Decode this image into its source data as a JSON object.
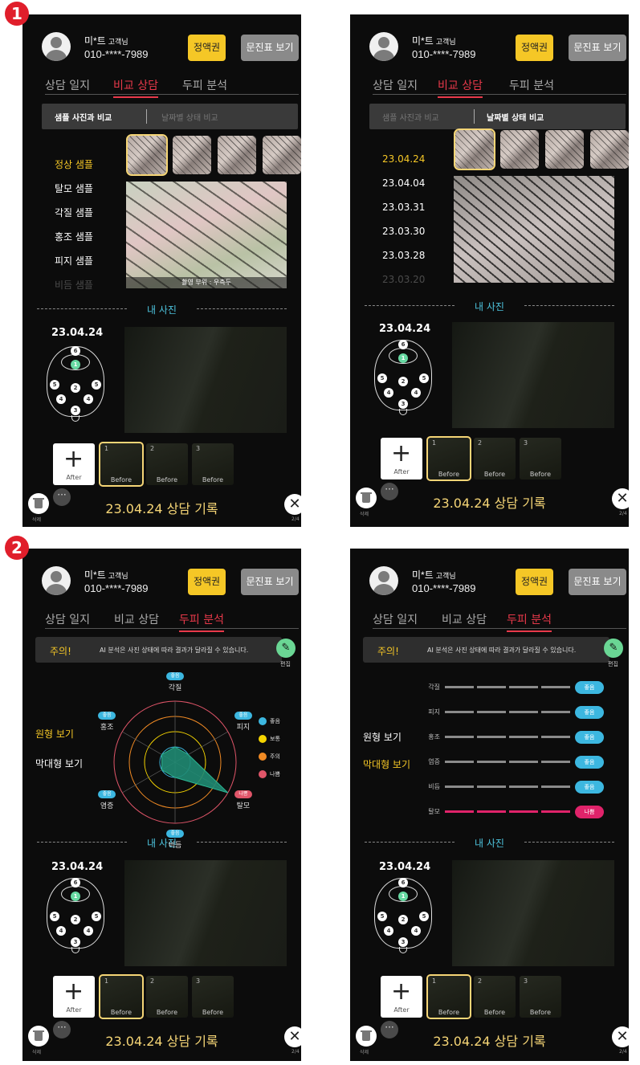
{
  "markers": [
    "1",
    "2"
  ],
  "customer": {
    "name": "미*트",
    "suffix": "고객님",
    "phone": "010-****-7989"
  },
  "buttons": {
    "ticket": "정액권",
    "survey": "문진표 보기",
    "add_after": "After",
    "more": "···",
    "close": "✕"
  },
  "tabs": [
    "상담 일지",
    "비교 상담",
    "두피 분석"
  ],
  "compare": {
    "sub_tabs": [
      "샘플 사진과 비교",
      "날짜별 상태 비교"
    ],
    "samples": [
      "정상 샘플",
      "탈모 샘플",
      "각질 샘플",
      "홍조 샘플",
      "피지 샘플",
      "비듬 샘플"
    ],
    "dates": [
      "23.04.24",
      "23.04.04",
      "23.03.31",
      "23.03.30",
      "23.03.28",
      "23.03.20"
    ],
    "photo_caption": "촬영 부위 : 우측두"
  },
  "my_photo": {
    "title": "내 사진",
    "date": "23.04.24",
    "head_points": [
      "6",
      "1",
      "5",
      "2",
      "5",
      "4",
      "4",
      "3"
    ],
    "slots": [
      {
        "num": "1",
        "label": "Before"
      },
      {
        "num": "2",
        "label": "Before"
      },
      {
        "num": "3",
        "label": "Before"
      }
    ]
  },
  "footer": {
    "trash_label": "삭제",
    "record": "23.04.24 상담 기록",
    "page": "2/4"
  },
  "analysis": {
    "notice_label": "주의!",
    "notice_text": "AI 분석은 사진 상태에 따라 결과가 달라질 수 있습니다.",
    "edit_label": "편집",
    "view_options": [
      "원형 보기",
      "막대형 보기"
    ],
    "legend": [
      {
        "label": "좋음",
        "color": "#3cb7e0"
      },
      {
        "label": "보통",
        "color": "#f5d400"
      },
      {
        "label": "주의",
        "color": "#f08a24"
      },
      {
        "label": "나쁨",
        "color": "#e05569"
      }
    ]
  },
  "chart_data": [
    {
      "type": "radar",
      "categories": [
        "각질",
        "피지",
        "탈모",
        "비듬",
        "염증",
        "홍조"
      ],
      "values": [
        1,
        1,
        4,
        1,
        1,
        1
      ],
      "status": [
        "좋음",
        "좋음",
        "나쁨",
        "좋음",
        "좋음",
        "좋음"
      ],
      "scale": [
        "좋음",
        "보통",
        "주의",
        "나쁨"
      ]
    },
    {
      "type": "bar",
      "categories": [
        "각질",
        "피지",
        "홍조",
        "염증",
        "비듬",
        "탈모"
      ],
      "values": [
        4,
        4,
        4,
        4,
        4,
        4
      ],
      "status": [
        "좋음",
        "좋음",
        "좋음",
        "좋음",
        "좋음",
        "나쁨"
      ],
      "status_colors": [
        "#3cb7e0",
        "#3cb7e0",
        "#3cb7e0",
        "#3cb7e0",
        "#3cb7e0",
        "#e0236a"
      ]
    }
  ]
}
